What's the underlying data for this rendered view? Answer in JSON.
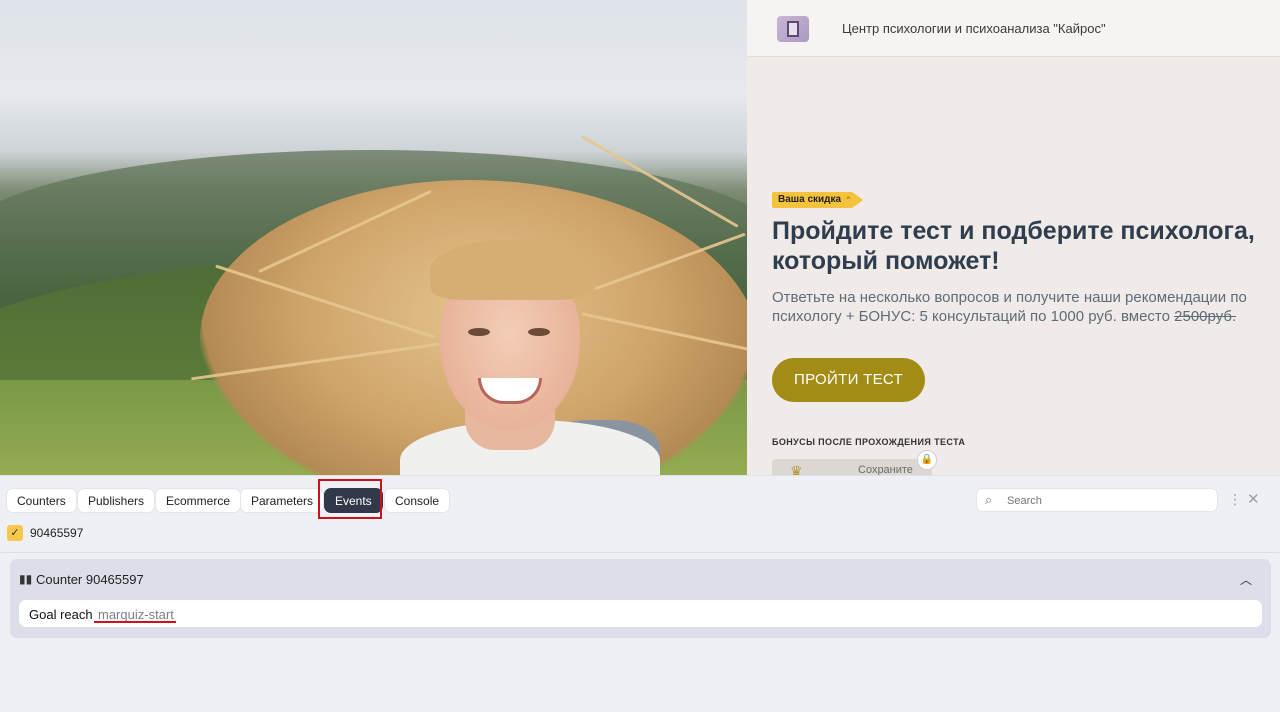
{
  "site": {
    "brand": "Центр психологии и психоанализа \"Кайрос\"",
    "discount_badge": "Ваша скидка",
    "headline": "Пройдите тест и подберите психолога, который поможет!",
    "subtext": "Ответьте на несколько вопросов и получите наши рекомендации по психологу + БОНУС: 5 консультаций по 1000 руб. вместо",
    "old_price": "2500руб.",
    "cta_label": "ПРОЙТИ ТЕСТ",
    "bonus_title": "БОНУСЫ ПОСЛЕ ПРОХОЖДЕНИЯ ТЕСТА",
    "bonus_card_label": "Сохраните",
    "colors": {
      "cta": "#a38c16",
      "badge": "#f5c33b",
      "panel_bg": "#f0ebe8"
    }
  },
  "devtools": {
    "tabs": [
      {
        "label": "Counters",
        "active": false
      },
      {
        "label": "Publishers",
        "active": false
      },
      {
        "label": "Ecommerce",
        "active": false
      },
      {
        "label": "Parameters",
        "active": false
      },
      {
        "label": "Events",
        "active": true
      },
      {
        "label": "Console",
        "active": false
      }
    ],
    "search_placeholder": "Search",
    "counter_filter": {
      "id": "90465597",
      "checked": true
    },
    "group": {
      "title": "Counter 90465597",
      "events": [
        {
          "type": "Goal reach",
          "name": "marquiz-start"
        }
      ]
    },
    "colors": {
      "active_tab": "#2f3949",
      "highlight": "#d0111b",
      "check": "#f6c84b"
    }
  }
}
